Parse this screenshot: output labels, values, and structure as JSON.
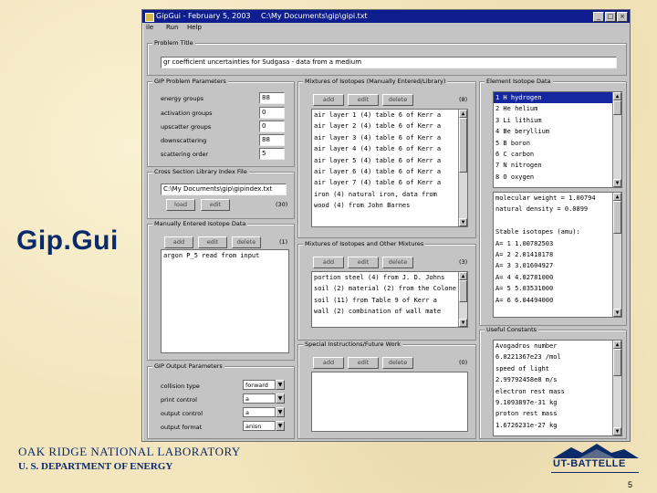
{
  "slide": {
    "title": "Gip.Gui",
    "footer_lab": "OAK RIDGE NATIONAL LABORATORY",
    "footer_dept": "U. S. DEPARTMENT OF ENERGY",
    "logo": "UT-BATTELLE",
    "page_number": "5"
  },
  "window": {
    "title": "GipGui - February 5, 2003",
    "path": "C:\\My Documents\\gip\\gipi.txt",
    "minimize": "_",
    "maximize": "□",
    "close": "×",
    "menu": [
      "ile",
      "Run",
      "Help"
    ]
  },
  "problem_title": {
    "legend": "Problem Title",
    "value": "gr coefficient uncertainties for Sudgasa - data from a medium"
  },
  "gip_params": {
    "legend": "GIP Problem Parameters",
    "fields": [
      {
        "label": "energy groups",
        "value": "88"
      },
      {
        "label": "activation groups",
        "value": "0"
      },
      {
        "label": "upscatter groups",
        "value": "0"
      },
      {
        "label": "downscattering",
        "value": "88"
      },
      {
        "label": "scattering order",
        "value": "5"
      }
    ]
  },
  "xs_file": {
    "legend": "Cross Section Library Index File",
    "value": "C:\\My Documents\\gip\\gipindex.txt",
    "buttons": [
      "load",
      "edit"
    ],
    "count": "(30)"
  },
  "manual_isotope": {
    "legend": "Manually Entered Isotope Data",
    "buttons": [
      "add",
      "edit",
      "delete"
    ],
    "count": "(1)",
    "rows": [
      "argon P_5 read from input"
    ]
  },
  "mixtures_isotopes": {
    "legend": "Mixtures of Isotopes (Manually Entered/Library)",
    "buttons": [
      "add",
      "edit",
      "delete"
    ],
    "count": "(8)",
    "rows": [
      "air layer 1 (4) table 6 of Kerr a",
      "air layer 2 (4) table 6 of Kerr a",
      "air layer 3 (4) table 6 of Kerr a",
      "air layer 4 (4) table 6 of Kerr a",
      "air layer 5 (4) table 6 of Kerr a",
      "air layer 6 (4) table 6 of Kerr a",
      "air layer 7 (4) table 6 of Kerr a",
      "iron (4) natural iron, data from",
      "wood (4) from John Barnes"
    ]
  },
  "mixtures_other": {
    "legend": "Mixtures of Isotopes and Other Mixtures",
    "buttons": [
      "add",
      "edit",
      "delete"
    ],
    "count": "(3)",
    "rows": [
      "portion steel (4) from J. D. Johns",
      "soil (2) material (2) from the Colone",
      "soil (11) from Table 9 of Kerr a",
      "wall (2) combination of wall mate"
    ]
  },
  "special": {
    "legend": "Special Instructions/Future Work",
    "buttons": [
      "add",
      "edit",
      "delete"
    ],
    "count": "(0)"
  },
  "gip_output": {
    "legend": "GIP Output Parameters",
    "fields": [
      {
        "label": "collision type",
        "value": "forward"
      },
      {
        "label": "print control",
        "value": "a"
      },
      {
        "label": "output control",
        "value": "a"
      },
      {
        "label": "output format",
        "value": "anisn"
      }
    ]
  },
  "element_data": {
    "legend": "Element Isotope Data",
    "elements": [
      "1  H  hydrogen",
      "2  He helium",
      "3  Li lithium",
      "4  Be beryllium",
      "5  B  boron",
      "6  C  carbon",
      "7  N  nitrogen",
      "8  O  oxygen"
    ],
    "details": [
      "molecular weight = 1.00794",
      "natural density = 0.0899",
      "",
      "Stable isotopes (amu):",
      "A=  1   1.00782503",
      "A=  2   2.01410178",
      "A=  3   3.01604927",
      "A=  4   4.02781000",
      "A=  5   5.03531000",
      "A=  6   6.04494000"
    ]
  },
  "constants": {
    "legend": "Useful Constants",
    "rows": [
      "Avogadros number",
      "  6.0221367e23 /mol",
      "speed of light",
      "  2.99792458e8 m/s",
      "electron rest mass",
      "  9.1093897e-31 kg",
      "proton rest mass",
      "  1.6726231e-27 kg"
    ]
  }
}
